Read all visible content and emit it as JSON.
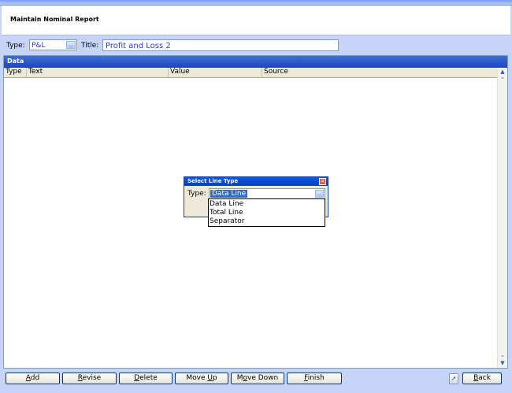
{
  "window": {
    "title": "Maintain Nominal Report"
  },
  "criteria": {
    "type_label": "Type:",
    "type_value": "P&L",
    "title_label": "Title:",
    "title_value": "Profit and Loss 2"
  },
  "data_panel": {
    "header": "Data",
    "columns": [
      "Type",
      "Text",
      "Value",
      "Source"
    ]
  },
  "dialog": {
    "title": "Select Line Type",
    "type_label": "Type:",
    "selected": "Data Line",
    "options": [
      "Data Line",
      "Total Line",
      "Separator"
    ]
  },
  "buttons": {
    "add_first": "A",
    "add_rest": "dd",
    "revise_first": "R",
    "revise_rest": "evise",
    "delete_first": "D",
    "delete_rest": "elete",
    "moveup_pre": "Move ",
    "moveup_key": "U",
    "moveup_post": "p",
    "movedown_pre": "M",
    "movedown_key": "o",
    "movedown_post": "ve Down",
    "finish_first": "F",
    "finish_rest": "inish",
    "back_first": "B",
    "back_rest": "ack"
  },
  "colors": {
    "accent": "#1e46b4",
    "background": "#c6d5f7",
    "value_text": "#2a3cc8"
  },
  "icons": [
    "dropdown-arrow-icon",
    "scroll-up-icon",
    "scroll-down-icon",
    "close-icon",
    "help-icon"
  ]
}
